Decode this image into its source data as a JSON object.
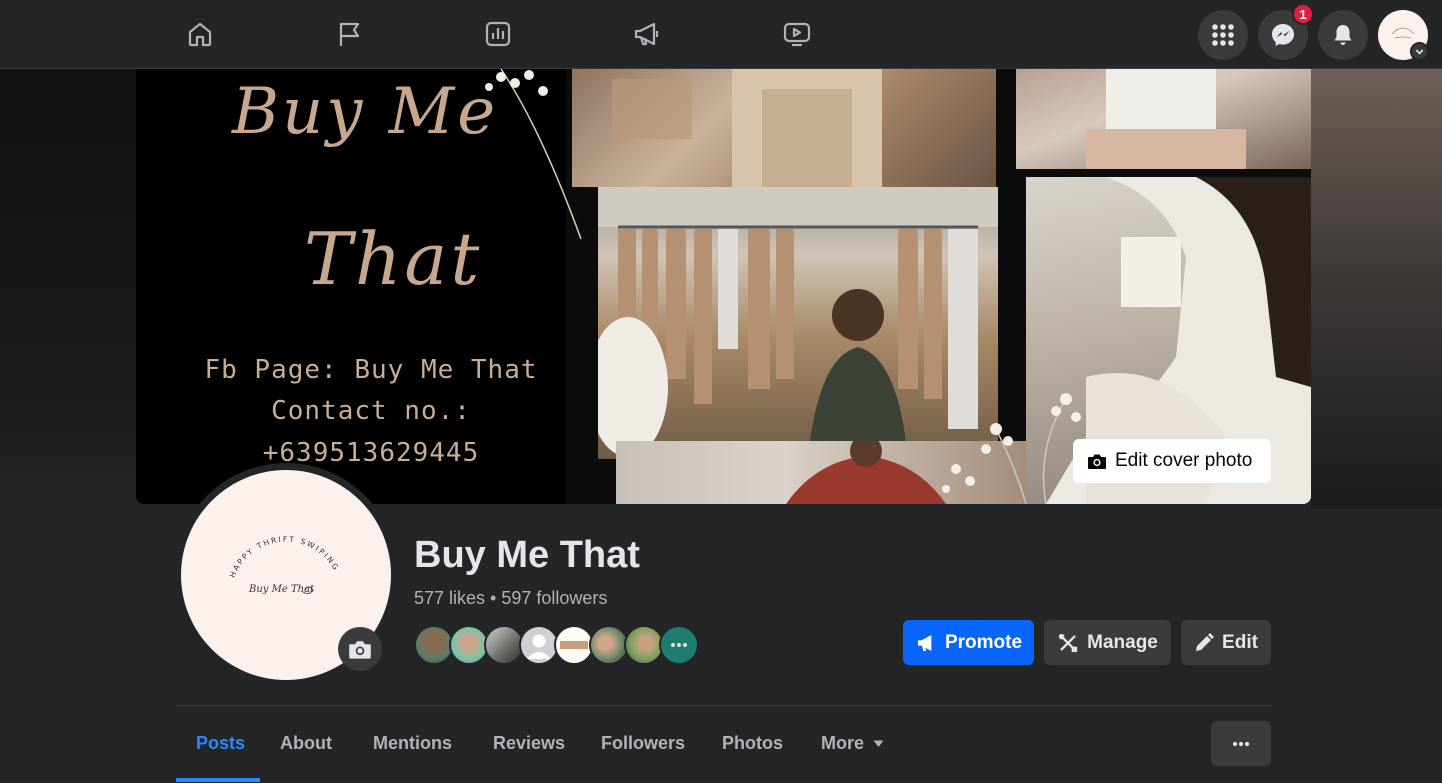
{
  "nav": {
    "icons": [
      "home-icon",
      "flag-icon",
      "insights-icon",
      "megaphone-icon",
      "watch-icon"
    ],
    "right_icons": [
      "menu-grid-icon",
      "messenger-icon",
      "bell-icon"
    ],
    "messenger_badge": "1"
  },
  "cover": {
    "script_line1": "Buy Me",
    "script_line2": "That",
    "info_line1": "Fb Page: Buy Me That",
    "info_line2": "Contact no.:",
    "info_line3": "+639513629445",
    "edit_cover_label": "Edit cover photo"
  },
  "profile": {
    "logo_arc_text": "HAPPY THRIFT SWIPING",
    "logo_signature": "Buy Me That",
    "name": "Buy Me That",
    "stats": "577 likes • 597 followers"
  },
  "actions": {
    "promote_label": "Promote",
    "manage_label": "Manage",
    "edit_label": "Edit"
  },
  "tabs": [
    {
      "label": "Posts"
    },
    {
      "label": "About"
    },
    {
      "label": "Mentions"
    },
    {
      "label": "Reviews"
    },
    {
      "label": "Followers"
    },
    {
      "label": "Photos"
    },
    {
      "label": "More"
    }
  ],
  "colors": {
    "accent": "#0866ff",
    "active_tab": "#2d88ff",
    "badge": "#e41e3f"
  }
}
